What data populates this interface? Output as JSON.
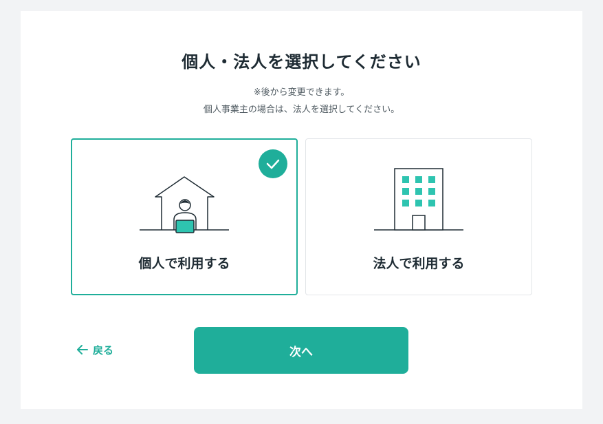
{
  "header": {
    "title": "個人・法人を選択してください",
    "note_line1": "※後から変更できます。",
    "note_line2": "個人事業主の場合は、法人を選択してください。"
  },
  "options": [
    {
      "label": "個人で利用する",
      "icon": "house-person-icon",
      "selected": true
    },
    {
      "label": "法人で利用する",
      "icon": "office-building-icon",
      "selected": false
    }
  ],
  "actions": {
    "back_label": "戻る",
    "next_label": "次へ"
  },
  "colors": {
    "accent": "#1fae9a",
    "text": "#1e2b33",
    "illustration_fill": "#2ec4b0",
    "background": "#f2f3f5"
  }
}
